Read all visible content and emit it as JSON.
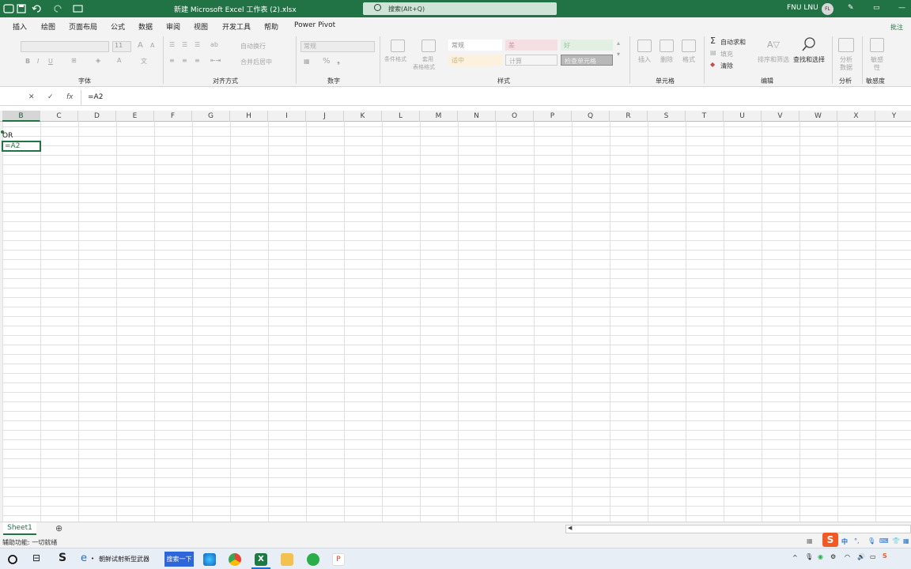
{
  "window": {
    "title": "新建 Microsoft Excel 工作表 (2).xlsx",
    "search_placeholder": "搜索(Alt+Q)",
    "user": "FNU LNU",
    "avatar": "FL"
  },
  "tabs": [
    "插入",
    "绘图",
    "页面布局",
    "公式",
    "数据",
    "审阅",
    "视图",
    "开发工具",
    "帮助",
    "Power Pivot"
  ],
  "ribbon": {
    "font": {
      "size": "11",
      "label": "字体"
    },
    "align": {
      "wrap": "自动换行",
      "merge": "合并后居中",
      "label": "对齐方式"
    },
    "number": {
      "format": "常规",
      "label": "数字"
    },
    "styles": {
      "cond": "条件格式",
      "table1": "套用",
      "table2": "表格格式",
      "normal": "常规",
      "bad": "差",
      "good": "好",
      "neutral": "适中",
      "calc": "计算",
      "check": "检查单元格",
      "label": "样式"
    },
    "cells": {
      "insert": "插入",
      "delete": "删除",
      "format": "格式",
      "label": "单元格"
    },
    "edit": {
      "autosum": "自动求和",
      "fill": "填充",
      "clear": "清除",
      "sort": "排序和筛选",
      "find": "查找和选择",
      "label": "编辑"
    },
    "analysis": {
      "a1": "分析",
      "a2": "数据",
      "label": "分析"
    },
    "sens": {
      "s1": "敏感",
      "s2": "性",
      "label": "敏感度"
    },
    "comment": "批注"
  },
  "formula": {
    "fx": "fx",
    "value": "=A2"
  },
  "columns": [
    "B",
    "C",
    "D",
    "E",
    "F",
    "G",
    "H",
    "I",
    "J",
    "K",
    "L",
    "M",
    "N",
    "O",
    "P",
    "Q",
    "R",
    "S",
    "T",
    "U",
    "V",
    "W",
    "X",
    "Y"
  ],
  "cells": {
    "b2": "OR",
    "b3": "=A2"
  },
  "sheet": {
    "name": "Sheet1"
  },
  "status": {
    "text": "辅助功能: 一切就绪"
  },
  "taskbar": {
    "item1": "朝鲜试射新型武器",
    "search_btn": "搜索一下",
    "ime": "中"
  }
}
